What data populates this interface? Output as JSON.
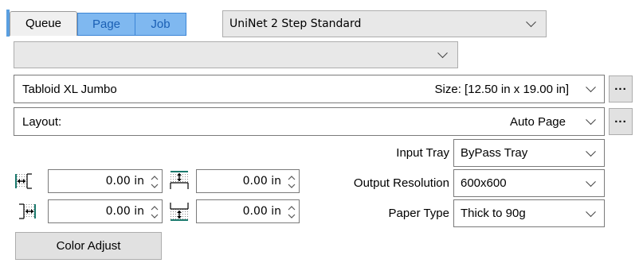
{
  "tabs": [
    {
      "label": "Queue",
      "active": true
    },
    {
      "label": "Page",
      "active": false
    },
    {
      "label": "Job",
      "active": false
    }
  ],
  "preset": {
    "value": "UniNet 2 Step Standard"
  },
  "secondary_combo": {
    "value": ""
  },
  "paper_size": {
    "name": "Tabloid XL Jumbo",
    "size_text": "Size: [12.50 in x 19.00 in]",
    "more_label": "..."
  },
  "layout": {
    "label": "Layout:",
    "value": "Auto Page",
    "more_label": "..."
  },
  "input_tray": {
    "label": "Input Tray",
    "value": "ByPass Tray"
  },
  "output_resolution": {
    "label": "Output Resolution",
    "value": "600x600"
  },
  "paper_type": {
    "label": "Paper Type",
    "value": "Thick to 90g"
  },
  "margins": {
    "left": "0.00 in",
    "top": "0.00 in",
    "right": "0.00 in",
    "bottom": "0.00 in"
  },
  "color_adjust_label": "Color Adjust",
  "colors": {
    "tab_inactive_bg": "#7fb8f0",
    "tab_inactive_text": "#1a5fb4",
    "icon_teal": "#1b7a6e"
  }
}
